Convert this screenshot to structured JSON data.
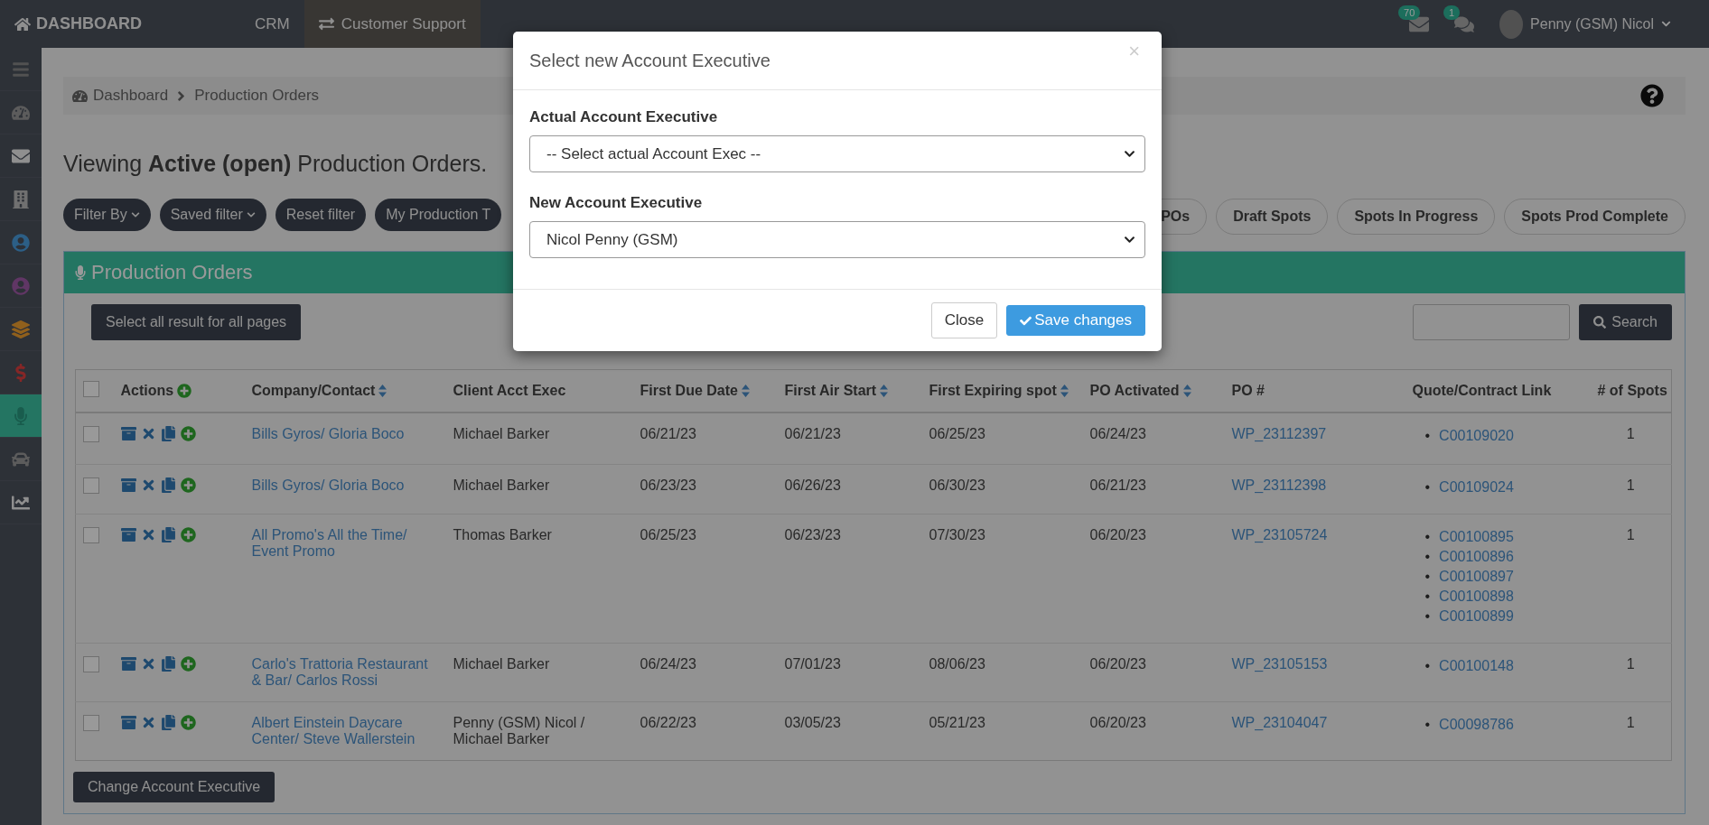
{
  "topbar": {
    "brand": "DASHBOARD",
    "nav": [
      {
        "label": "CRM",
        "selected": false
      },
      {
        "label": "Customer Support",
        "selected": true
      }
    ],
    "mail_badge": "70",
    "chat_badge": "1",
    "user": "Penny (GSM) Nicol"
  },
  "breadcrumb": [
    "Dashboard",
    "Production Orders"
  ],
  "heading": "Viewing **Active (open)** Production Orders.",
  "filters_left": [
    {
      "label": "Filter By",
      "dropdown": true
    },
    {
      "label": "Saved filter",
      "dropdown": true
    },
    {
      "label": "Reset filter",
      "dropdown": false
    },
    {
      "label": "My Production T",
      "dropdown": false
    }
  ],
  "filters_right": [
    "POs",
    "Draft Spots",
    "Spots In Progress",
    "Spots Prod Complete"
  ],
  "panel": {
    "title": "Production Orders",
    "header_checked": false,
    "quote_bullet": "•",
    "select_all_button": "Select all result for all pages",
    "search_button": "Search",
    "columns": [
      {
        "kind": "check"
      },
      {
        "label": "Actions",
        "kind": "actions"
      },
      {
        "label": "Company/Contact",
        "kind": "sortable"
      },
      {
        "label": "Client Acct Exec",
        "kind": "plain"
      },
      {
        "label": "First Due Date",
        "kind": "sortable"
      },
      {
        "label": "First Air Start",
        "kind": "sortable"
      },
      {
        "label": "First Expiring spot",
        "kind": "sortable"
      },
      {
        "label": "PO Activated",
        "kind": "sortable"
      },
      {
        "label": "PO #",
        "kind": "plain"
      },
      {
        "label": "Quote/Contract Link",
        "kind": "plain"
      },
      {
        "label": "# of Spots",
        "kind": "plain"
      }
    ],
    "rows": [
      {
        "checked": false,
        "company": "Bills Gyros/ Gloria Boco",
        "exec": "Michael Barker",
        "due": "06/21/23",
        "air": "06/21/23",
        "expiring": "06/25/23",
        "activated": "06/24/23",
        "po": "WP_23112397",
        "quotes": [
          "C00109020"
        ],
        "spots": "1"
      },
      {
        "checked": false,
        "company": "Bills Gyros/ Gloria Boco",
        "exec": "Michael Barker",
        "due": "06/23/23",
        "air": "06/26/23",
        "expiring": "06/30/23",
        "activated": "06/21/23",
        "po": "WP_23112398",
        "quotes": [
          "C00109024"
        ],
        "spots": "1"
      },
      {
        "checked": false,
        "company": "All Promo's All the Time/ Event Promo",
        "exec": "Thomas Barker",
        "due": "06/25/23",
        "air": "06/23/23",
        "expiring": "07/30/23",
        "activated": "06/20/23",
        "po": "WP_23105724",
        "quotes": [
          "C00100895",
          "C00100896",
          "C00100897",
          "C00100898",
          "C00100899"
        ],
        "spots": "1"
      },
      {
        "checked": false,
        "company": "Carlo's Trattoria Restaurant & Bar/ Carlos Rossi",
        "exec": "Michael Barker",
        "due": "06/24/23",
        "air": "07/01/23",
        "expiring": "08/06/23",
        "activated": "06/20/23",
        "po": "WP_23105153",
        "quotes": [
          "C00100148"
        ],
        "spots": "1"
      },
      {
        "checked": false,
        "company": "Albert Einstein Daycare Center/ Steve Wallerstein",
        "exec": "Penny (GSM) Nicol / Michael Barker",
        "due": "06/22/23",
        "air": "03/05/23",
        "expiring": "05/21/23",
        "activated": "06/20/23",
        "po": "WP_23104047",
        "quotes": [
          "C00098786"
        ],
        "spots": "1"
      }
    ],
    "change_button": "Change Account Executive"
  },
  "modal": {
    "title": "Select new Account Executive",
    "close_glyph": "×",
    "fields": [
      {
        "label": "Actual Account Executive",
        "value": "-- Select actual Account Exec --"
      },
      {
        "label": "New Account Executive",
        "value": "Nicol Penny (GSM)"
      }
    ],
    "buttons": [
      {
        "label": "Close",
        "kind": "default"
      },
      {
        "label": "Save changes",
        "kind": "primary"
      }
    ]
  }
}
